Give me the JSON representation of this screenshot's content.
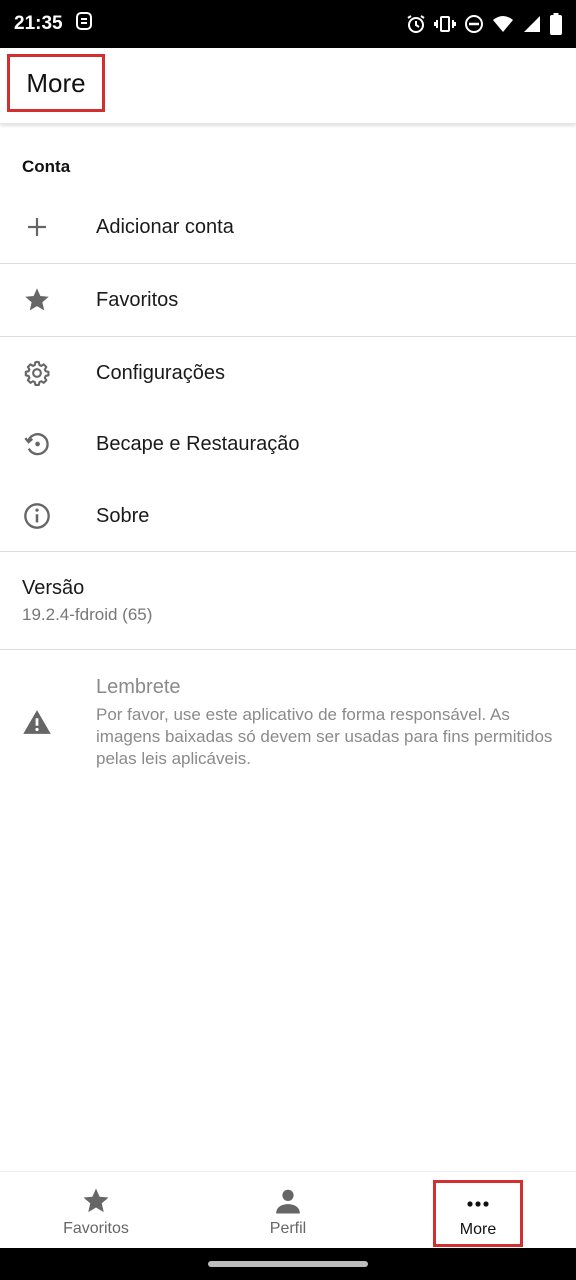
{
  "status_bar": {
    "time": "21:35",
    "icons": [
      "notification-app-icon",
      "alarm-icon",
      "vibrate-icon",
      "dnd-icon",
      "wifi-icon",
      "signal-icon",
      "battery-icon"
    ]
  },
  "app_bar": {
    "title": "More"
  },
  "sections": {
    "account_header": "Conta",
    "items": [
      {
        "label": "Adicionar conta",
        "icon": "plus-icon"
      },
      {
        "label": "Favoritos",
        "icon": "star-icon"
      },
      {
        "label": "Configurações",
        "icon": "gear-icon"
      },
      {
        "label": "Becape e Restauração",
        "icon": "restore-icon"
      },
      {
        "label": "Sobre",
        "icon": "info-icon"
      }
    ]
  },
  "version": {
    "title": "Versão",
    "value": "19.2.4-fdroid (65)"
  },
  "reminder": {
    "title": "Lembrete",
    "body": "Por favor, use este aplicativo de forma responsável. As imagens baixadas só devem ser usadas para fins permitidos pelas leis aplicáveis.",
    "icon": "warning-icon"
  },
  "bottom_nav": {
    "items": [
      {
        "label": "Favoritos",
        "icon": "star-icon"
      },
      {
        "label": "Perfil",
        "icon": "person-icon"
      },
      {
        "label": "More",
        "icon": "more-dots-icon",
        "selected": true
      }
    ]
  },
  "colors": {
    "highlight": "#d32f2f",
    "icon_gray": "#666666",
    "text_secondary": "#8a8a8a"
  }
}
